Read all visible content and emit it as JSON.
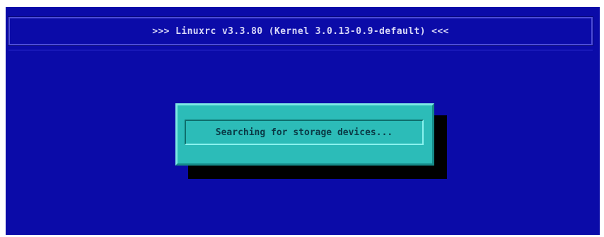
{
  "header": {
    "title": ">>> Linuxrc v3.3.80 (Kernel 3.0.13-0.9-default) <<<"
  },
  "dialog": {
    "message": "Searching for storage devices..."
  },
  "colors": {
    "background": "#0b0ba8",
    "dialog": "#2cbcb8",
    "shadow": "#000000",
    "text_light": "#d8d8f8",
    "text_dark": "#0a3a46"
  }
}
